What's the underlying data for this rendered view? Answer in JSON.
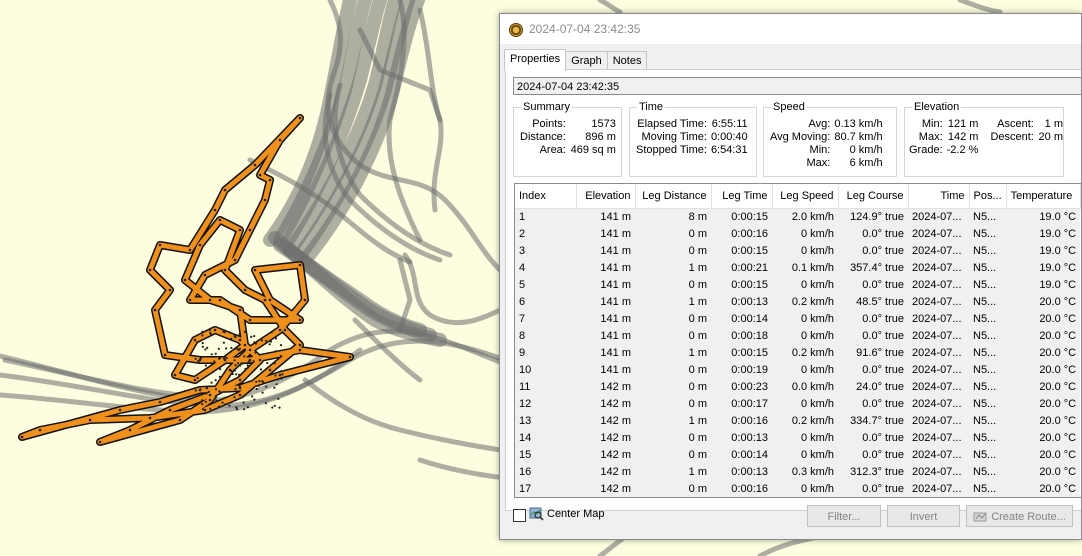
{
  "window": {
    "title": "2024-07-04 23:42:35"
  },
  "tabs": [
    {
      "label": "Properties"
    },
    {
      "label": "Graph"
    },
    {
      "label": "Notes"
    }
  ],
  "name_field": {
    "value": "2024-07-04 23:42:35"
  },
  "summary": {
    "caption": "Summary",
    "rows": [
      [
        "Points:",
        "1573"
      ],
      [
        "Distance:",
        "896 m"
      ],
      [
        "Area:",
        "469 sq m"
      ]
    ]
  },
  "time": {
    "caption": "Time",
    "rows": [
      [
        "Elapsed Time:",
        "6:55:11"
      ],
      [
        "Moving Time:",
        "0:00:40"
      ],
      [
        "Stopped Time:",
        "6:54:31"
      ]
    ]
  },
  "speed": {
    "caption": "Speed",
    "rows": [
      [
        "Avg:",
        "0.13 km/h"
      ],
      [
        "Avg Moving:",
        "80.7 km/h"
      ],
      [
        "Min:",
        "0 km/h"
      ],
      [
        "Max:",
        "6 km/h"
      ]
    ]
  },
  "elevation": {
    "caption": "Elevation",
    "rows": [
      [
        "Min:",
        "121 m",
        "Ascent:",
        "1 m"
      ],
      [
        "Max:",
        "142 m",
        "Descent:",
        "20 m"
      ],
      [
        "Grade:",
        "-2.2 %",
        "",
        ""
      ]
    ]
  },
  "table": {
    "columns": [
      "Index",
      "Elevation",
      "Leg Distance",
      "Leg Time",
      "Leg Speed",
      "Leg Course",
      "Time",
      "Pos...",
      "Temperature"
    ],
    "rows": [
      [
        "1",
        "141 m",
        "8 m",
        "0:00:15",
        "2.0 km/h",
        "124.9° true",
        "2024-07...",
        "N5...",
        "19.0 °C"
      ],
      [
        "2",
        "141 m",
        "0 m",
        "0:00:16",
        "0 km/h",
        "0.0° true",
        "2024-07...",
        "N5...",
        "19.0 °C"
      ],
      [
        "3",
        "141 m",
        "0 m",
        "0:00:15",
        "0 km/h",
        "0.0° true",
        "2024-07...",
        "N5...",
        "19.0 °C"
      ],
      [
        "4",
        "141 m",
        "1 m",
        "0:00:21",
        "0.1 km/h",
        "357.4° true",
        "2024-07...",
        "N5...",
        "19.0 °C"
      ],
      [
        "5",
        "141 m",
        "0 m",
        "0:00:15",
        "0 km/h",
        "0.0° true",
        "2024-07...",
        "N5...",
        "19.0 °C"
      ],
      [
        "6",
        "141 m",
        "1 m",
        "0:00:13",
        "0.2 km/h",
        "48.5° true",
        "2024-07...",
        "N5...",
        "20.0 °C"
      ],
      [
        "7",
        "141 m",
        "0 m",
        "0:00:14",
        "0 km/h",
        "0.0° true",
        "2024-07...",
        "N5...",
        "20.0 °C"
      ],
      [
        "8",
        "141 m",
        "0 m",
        "0:00:18",
        "0 km/h",
        "0.0° true",
        "2024-07...",
        "N5...",
        "20.0 °C"
      ],
      [
        "9",
        "141 m",
        "1 m",
        "0:00:15",
        "0.2 km/h",
        "91.6° true",
        "2024-07...",
        "N5...",
        "20.0 °C"
      ],
      [
        "10",
        "141 m",
        "0 m",
        "0:00:19",
        "0 km/h",
        "0.0° true",
        "2024-07...",
        "N5...",
        "20.0 °C"
      ],
      [
        "11",
        "142 m",
        "0 m",
        "0:00:23",
        "0.0 km/h",
        "24.0° true",
        "2024-07...",
        "N5...",
        "20.0 °C"
      ],
      [
        "12",
        "142 m",
        "0 m",
        "0:00:17",
        "0 km/h",
        "0.0° true",
        "2024-07...",
        "N5...",
        "20.0 °C"
      ],
      [
        "13",
        "142 m",
        "1 m",
        "0:00:16",
        "0.2 km/h",
        "334.7° true",
        "2024-07...",
        "N5...",
        "20.0 °C"
      ],
      [
        "14",
        "142 m",
        "0 m",
        "0:00:13",
        "0 km/h",
        "0.0° true",
        "2024-07...",
        "N5...",
        "20.0 °C"
      ],
      [
        "15",
        "142 m",
        "0 m",
        "0:00:14",
        "0 km/h",
        "0.0° true",
        "2024-07...",
        "N5...",
        "20.0 °C"
      ],
      [
        "16",
        "142 m",
        "1 m",
        "0:00:13",
        "0.3 km/h",
        "312.3° true",
        "2024-07...",
        "N5...",
        "20.0 °C"
      ],
      [
        "17",
        "142 m",
        "0 m",
        "0:00:16",
        "0 km/h",
        "0.0° true",
        "2024-07...",
        "N5...",
        "20.0 °C"
      ]
    ]
  },
  "footer": {
    "center_map_label": "Center Map",
    "center_map_checked": false,
    "filter_label": "Filter...",
    "invert_label": "Invert",
    "create_route_label": "Create Route..."
  },
  "icons": {
    "app": "garmin-basecamp-icon",
    "center_map": "map-magnifier-icon",
    "create_route": "route-icon"
  },
  "colors": {
    "map_background": "#fdfde0",
    "track_gray": "#707070",
    "track_highlight": "#f0901c"
  }
}
